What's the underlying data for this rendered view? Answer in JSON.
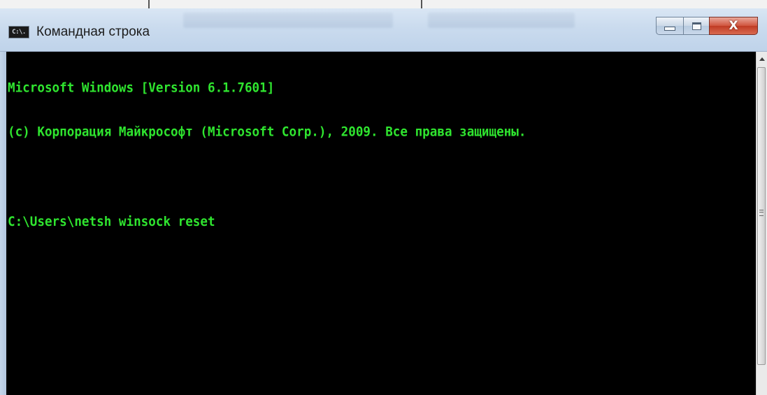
{
  "window": {
    "title": "Командная строка",
    "icon_text": "C:\\.",
    "icon": "console-app-icon"
  },
  "controls": {
    "minimize": "minimize-icon",
    "maximize": "maximize-icon",
    "close_glyph": "X"
  },
  "console": {
    "lines": [
      "Microsoft Windows [Version 6.1.7601]",
      "(c) Корпорация Майкрософт (Microsoft Corp.), 2009. Все права защищены.",
      "",
      "C:\\Users\\netsh winsock reset"
    ],
    "text_color": "#2fe52f",
    "background_color": "#000000"
  }
}
